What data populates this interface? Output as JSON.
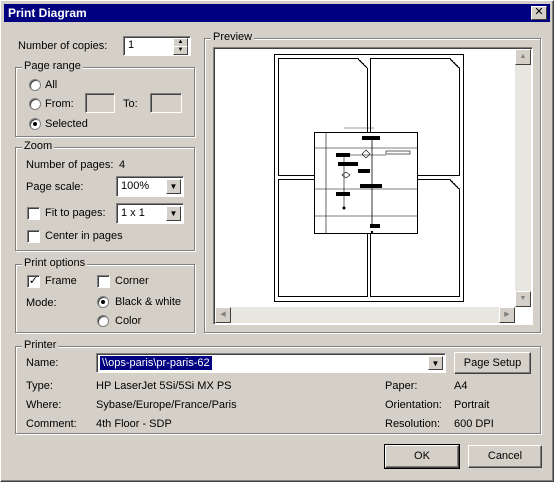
{
  "window": {
    "title": "Print Diagram",
    "close_glyph": "✕"
  },
  "copies": {
    "label": "Number of copies:",
    "value": "1"
  },
  "page_range": {
    "title": "Page range",
    "all_label": "All",
    "from_label": "From:",
    "to_label": "To:",
    "selected_label": "Selected",
    "selected_option": "Selected"
  },
  "zoom": {
    "title": "Zoom",
    "num_pages_label": "Number of pages:",
    "num_pages_value": "4",
    "page_scale_label": "Page scale:",
    "page_scale_value": "100%",
    "fit_label": "Fit to pages:",
    "fit_value": "1 x 1",
    "fit_checked": false,
    "center_label": "Center in pages",
    "center_checked": false
  },
  "print_options": {
    "title": "Print options",
    "frame_label": "Frame",
    "frame_checked": true,
    "corner_label": "Corner",
    "corner_checked": false,
    "mode_label": "Mode:",
    "bw_label": "Black & white",
    "color_label": "Color",
    "mode_selected": "Black & white"
  },
  "preview": {
    "title": "Preview"
  },
  "printer": {
    "title": "Printer",
    "name_label": "Name:",
    "name_value": "\\\\ops-paris\\pr-paris-62",
    "page_setup_label": "Page Setup",
    "type_label": "Type:",
    "type_value": "HP LaserJet 5Si/5Si MX PS",
    "where_label": "Where:",
    "where_value": "Sybase/Europe/France/Paris",
    "comment_label": "Comment:",
    "comment_value": "4th Floor - SDP",
    "paper_label": "Paper:",
    "paper_value": "A4",
    "orientation_label": "Orientation:",
    "orientation_value": "Portrait",
    "resolution_label": "Resolution:",
    "resolution_value": "600 DPI"
  },
  "buttons": {
    "ok": "OK",
    "cancel": "Cancel"
  },
  "icons": {
    "dropdown": "chevron-down-icon",
    "spin_up": "arrow-up-icon",
    "spin_down": "arrow-down-icon",
    "scroll_up": "scroll-up-icon",
    "scroll_down": "scroll-down-icon",
    "scroll_left": "scroll-left-icon",
    "scroll_right": "scroll-right-icon"
  }
}
